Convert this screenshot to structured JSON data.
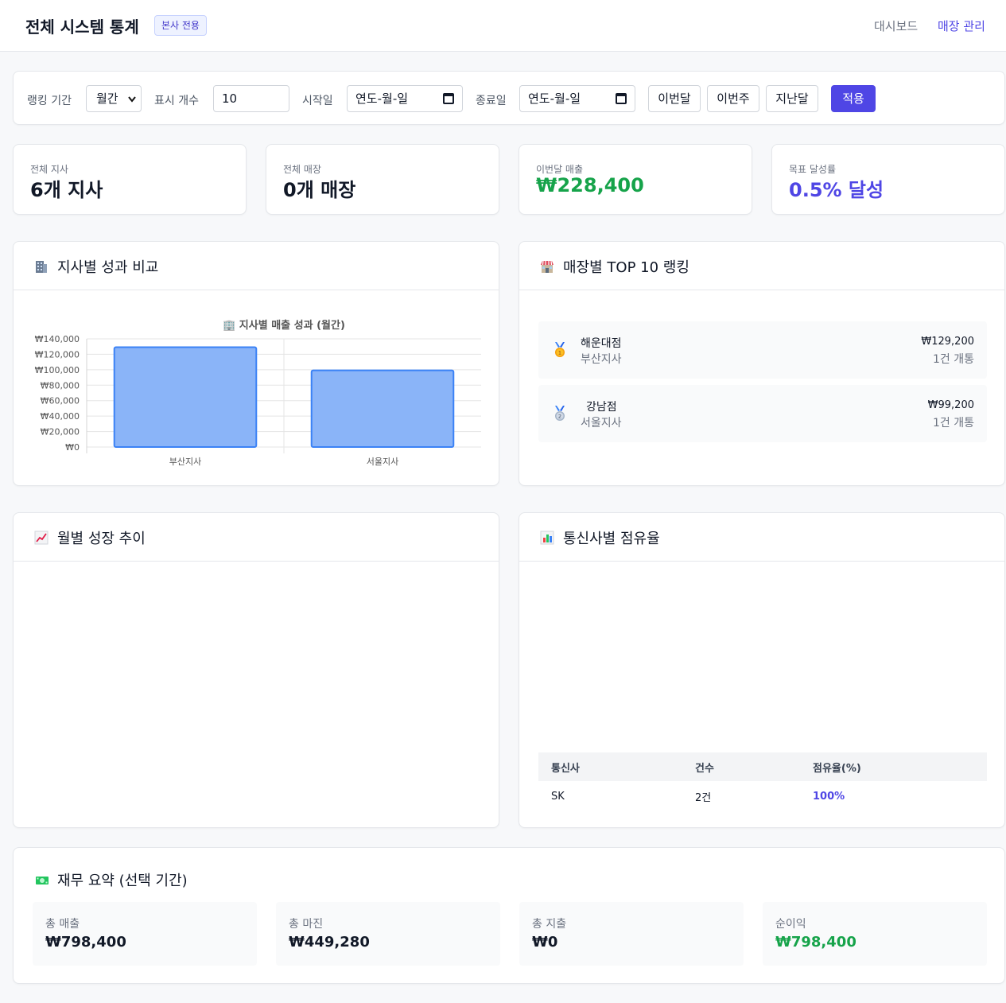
{
  "header": {
    "title": "전체 시스템 통계",
    "badge": "본사 전용",
    "nav": [
      "대시보드",
      "매장 관리"
    ]
  },
  "filters": {
    "period_label": "랭킹 기간",
    "period_value": "월간",
    "count_label": "표시 개수",
    "count_value": "10",
    "start_label": "시작일",
    "start_placeholder": "연도-월-일",
    "end_label": "종료일",
    "end_placeholder": "연도-월-일",
    "quick_buttons": [
      "이번달",
      "이번주",
      "지난달"
    ],
    "apply_label": "적용"
  },
  "stats": [
    {
      "label": "전체 지사",
      "value": "6개 지사"
    },
    {
      "label": "전체 매장",
      "value": "0개 매장"
    },
    {
      "label": "이번달 매출",
      "value": "₩228,400",
      "color": "#16a34a"
    },
    {
      "label": "목표 달성률",
      "value": "0.5% 달성",
      "color": "#4f46e5"
    }
  ],
  "branch_panel": {
    "title": "지사별 성과 비교",
    "icon": "office-building-icon"
  },
  "chart_data": {
    "type": "bar",
    "title": "🏢 지사별 매출 성과 (월간)",
    "categories": [
      "부산지사",
      "서울지사"
    ],
    "values": [
      129200,
      99200
    ],
    "ylim": [
      0,
      140000
    ],
    "yticks": [
      "₩0",
      "₩20,000",
      "₩40,000",
      "₩60,000",
      "₩80,000",
      "₩100,000",
      "₩120,000",
      "₩140,000"
    ],
    "grid": true,
    "color": "#8ab4f8",
    "border_color": "#3b82f6"
  },
  "ranking_panel": {
    "title": "매장별 TOP 10 랭킹",
    "icon": "store-icon",
    "items": [
      {
        "rank": "1",
        "name": "해운대점",
        "branch": "부산지사",
        "amount": "₩129,200",
        "count": "1건 개통",
        "medal": "gold-medal-icon"
      },
      {
        "rank": "2",
        "name": "강남점",
        "branch": "서울지사",
        "amount": "₩99,200",
        "count": "1건 개통",
        "medal": "silver-medal-icon"
      }
    ]
  },
  "trend_panel": {
    "title": "월별 성장 추이",
    "icon": "chart-increasing-icon"
  },
  "carrier_panel": {
    "title": "통신사별 점유율",
    "icon": "bar-chart-icon",
    "columns": [
      "통신사",
      "건수",
      "점유율(%)"
    ],
    "rows": [
      {
        "carrier": "SK",
        "count": "2건",
        "share": "100%"
      }
    ]
  },
  "finance": {
    "title": "재무 요약 (선택 기간)",
    "icon": "money-icon",
    "items": [
      {
        "label": "총 매출",
        "value": "₩798,400"
      },
      {
        "label": "총 마진",
        "value": "₩449,280"
      },
      {
        "label": "총 지출",
        "value": "₩0"
      },
      {
        "label": "순이익",
        "value": "₩798,400",
        "color": "#16a34a"
      }
    ]
  }
}
